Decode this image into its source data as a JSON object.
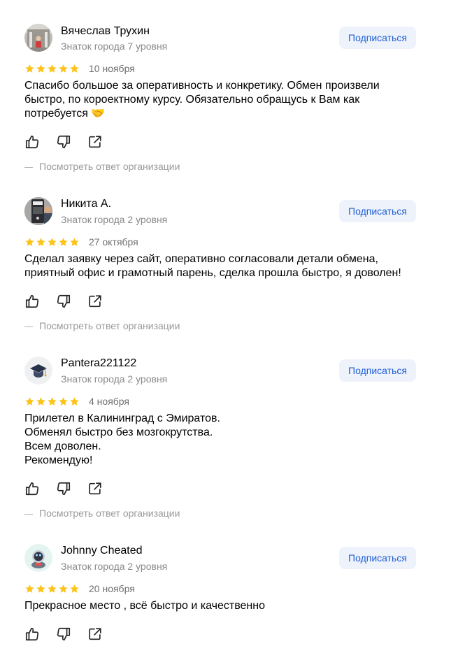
{
  "colors": {
    "star": "#fcc419",
    "accent": "#1f5fd6",
    "subscribe_bg": "#eef2fb",
    "muted": "#8a8a8a"
  },
  "icons": {
    "like": "thumbs-up-icon",
    "dislike": "thumbs-down-icon",
    "share": "share-icon",
    "star": "star-icon"
  },
  "reviews": [
    {
      "author": "Вячеслав Трухин",
      "level": "Знаток города 7 уровня",
      "subscribe_label": "Подписаться",
      "rating": 5,
      "date": "10 ноября",
      "text": "Спасибо большое за оперативность и конкретику. Обмен произвели\nбыстро, по короектному курсу. Обязательно обращусь к Вам как\nпотребуется 🤝",
      "org_reply_label": "Посмотреть ответ организации"
    },
    {
      "author": "Никита А.",
      "level": "Знаток города 2 уровня",
      "subscribe_label": "Подписаться",
      "rating": 5,
      "date": "27 октября",
      "text": "Сделал заявку через сайт, оперативно согласовали детали обмена,\nприятный офис и грамотный парень, сделка прошла быстро, я доволен!",
      "org_reply_label": "Посмотреть ответ организации"
    },
    {
      "author": "Pantera221122",
      "level": "Знаток города 2 уровня",
      "subscribe_label": "Подписаться",
      "rating": 5,
      "date": "4 ноября",
      "text": "Прилетел в Калининград с Эмиратов.\nОбменял быстро без мозгокрутства.\nВсем доволен.\nРекомендую!",
      "org_reply_label": "Посмотреть ответ организации"
    },
    {
      "author": "Johnny Cheated",
      "level": "Знаток города 2 уровня",
      "subscribe_label": "Подписаться",
      "rating": 5,
      "date": "20 ноября",
      "text": "Прекрасное место , всё быстро и качественно"
    }
  ]
}
